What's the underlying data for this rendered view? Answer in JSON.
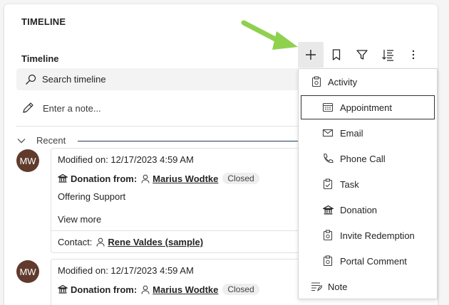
{
  "section": {
    "title": "TIMELINE"
  },
  "timeline": {
    "label": "Timeline"
  },
  "toolbar": {
    "buttons": [
      {
        "name": "add-icon",
        "label": "Create a timeline record"
      },
      {
        "name": "bookmark-icon",
        "label": "Bookmark"
      },
      {
        "name": "filter-icon",
        "label": "Filter"
      },
      {
        "name": "sort-icon",
        "label": "Sort"
      },
      {
        "name": "more-icon",
        "label": "More commands"
      }
    ]
  },
  "search": {
    "placeholder": "Search timeline"
  },
  "note": {
    "placeholder": "Enter a note..."
  },
  "recent": {
    "label": "Recent"
  },
  "posts": [
    {
      "avatar": "MW",
      "modified": "Modified on: 12/17/2023 4:59 AM",
      "title_prefix": "Donation from:",
      "person": "Marius Wodtke",
      "status": "Closed",
      "description": "Offering Support",
      "view_more": "View more",
      "contact_prefix": "Contact:",
      "contact": "Rene Valdes (sample)"
    },
    {
      "avatar": "MW",
      "modified": "Modified on: 12/17/2023 4:59 AM",
      "title_prefix": "Donation from:",
      "person": "Marius Wodtke",
      "status": "Closed"
    }
  ],
  "menu": {
    "items": [
      {
        "label": "Activity",
        "icon": "activity-icon",
        "level": "top"
      },
      {
        "label": "Appointment",
        "icon": "calendar-icon",
        "level": "sub",
        "focused": true
      },
      {
        "label": "Email",
        "icon": "mail-icon",
        "level": "sub"
      },
      {
        "label": "Phone Call",
        "icon": "phone-icon",
        "level": "sub"
      },
      {
        "label": "Task",
        "icon": "task-icon",
        "level": "sub"
      },
      {
        "label": "Donation",
        "icon": "bank-icon",
        "level": "sub"
      },
      {
        "label": "Invite Redemption",
        "icon": "activity-icon",
        "level": "sub"
      },
      {
        "label": "Portal Comment",
        "icon": "activity-icon",
        "level": "sub"
      },
      {
        "label": "Note",
        "icon": "note-icon",
        "level": "top"
      }
    ]
  },
  "colors": {
    "avatar_bg": "#603a2c",
    "arrow": "#8fd14f",
    "recent_line": "#1f3b5c"
  }
}
